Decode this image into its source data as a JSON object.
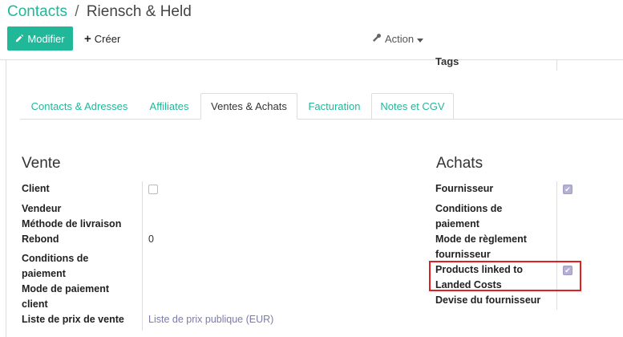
{
  "breadcrumb": {
    "parent": "Contacts",
    "separator": "/",
    "current": "Riensch & Held"
  },
  "toolbar": {
    "edit_label": "Modifier",
    "create_label": "Créer",
    "action_label": "Action"
  },
  "partial_field": {
    "tags_label": "Tags"
  },
  "tabs": [
    {
      "label": "Contacts & Adresses",
      "active": false
    },
    {
      "label": "Affiliates",
      "active": false
    },
    {
      "label": "Ventes & Achats",
      "active": true
    },
    {
      "label": "Facturation",
      "active": false
    },
    {
      "label": "Notes et CGV",
      "active": false
    }
  ],
  "vente": {
    "title": "Vente",
    "client_label": "Client",
    "client_checked": false,
    "vendeur_label": "Vendeur",
    "livraison_label": "Méthode de livraison",
    "rebond_label": "Rebond",
    "rebond_value": "0",
    "conditions_label_1": "Conditions de",
    "conditions_label_2": "paiement",
    "mode_label_1": "Mode de paiement",
    "mode_label_2": "client",
    "liste_prix_label": "Liste de prix de vente",
    "liste_prix_value": "Liste de prix publique (EUR)"
  },
  "achats": {
    "title": "Achats",
    "fournisseur_label": "Fournisseur",
    "fournisseur_checked": true,
    "conditions_label_1": "Conditions de",
    "conditions_label_2": "paiement",
    "mode_label_1": "Mode de règlement",
    "mode_label_2": "fournisseur",
    "landed_label_1": "Products linked to",
    "landed_label_2": "Landed Costs",
    "landed_checked": true,
    "devise_label": "Devise du fournisseur"
  },
  "colors": {
    "primary": "#21b799",
    "link": "#7c7bad",
    "highlight": "#e02020"
  }
}
